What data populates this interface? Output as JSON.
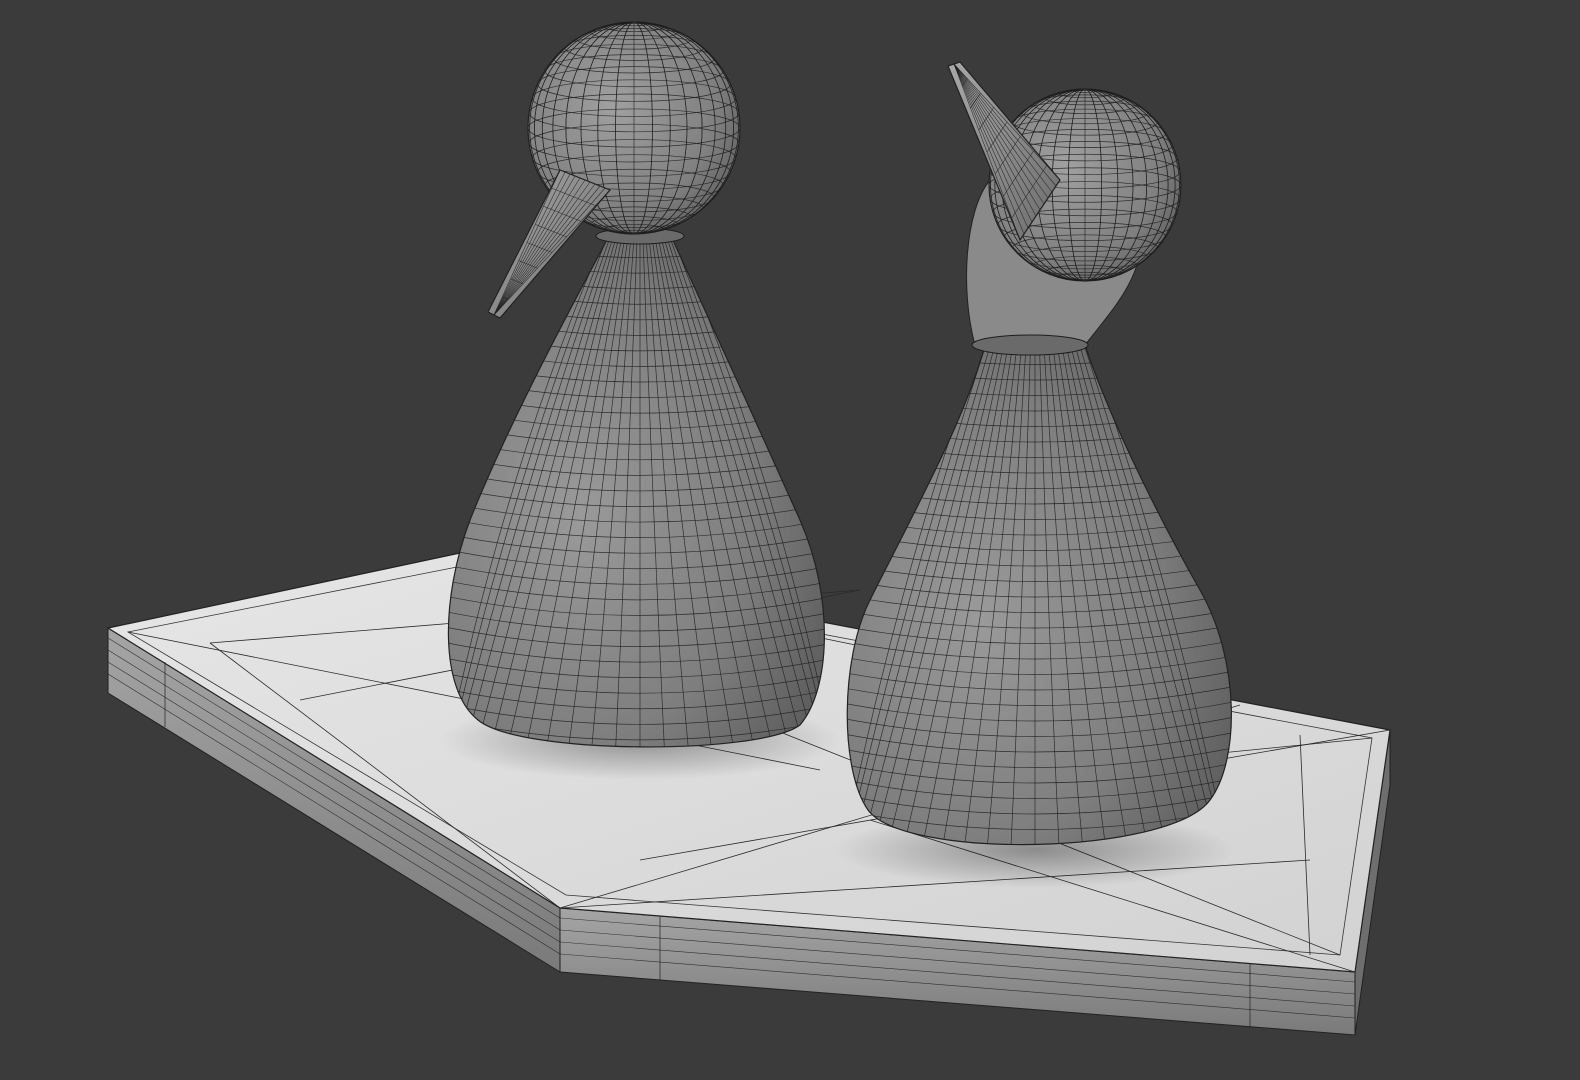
{
  "scene": {
    "background_color": "#3b3b3b",
    "render_mode": "smooth-shaded-with-wireframe",
    "objects": [
      {
        "name": "base-plate",
        "shape": "beveled-pentagon-slab",
        "color": "#dcdcdc",
        "side_color": "#8e8e8e"
      },
      {
        "name": "bird-left",
        "shape": "cone-body-sphere-head-beak",
        "beak_direction": "down-left",
        "color": "#8a8a8a"
      },
      {
        "name": "bird-right",
        "shape": "cone-body-sphere-head-beak",
        "beak_direction": "up-left",
        "color": "#8a8a8a"
      }
    ],
    "wire_color": "#1f1f1f"
  }
}
